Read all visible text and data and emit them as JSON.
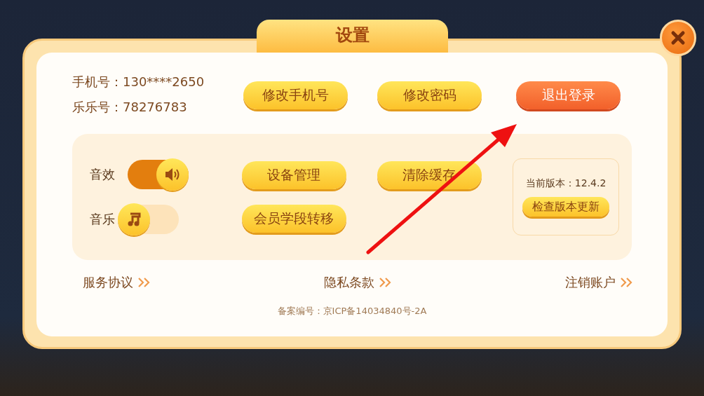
{
  "dialog": {
    "title": "设置"
  },
  "account": [
    "手机号：130****2650",
    "乐乐号：78276783"
  ],
  "account_buttons": [
    {
      "label": "修改手机号",
      "kind": "normal"
    },
    {
      "label": "修改密码",
      "kind": "normal"
    },
    {
      "label": "退出登录",
      "kind": "danger"
    }
  ],
  "toggles": [
    {
      "label": "音效",
      "kind": "sound",
      "on": true
    },
    {
      "label": "音乐",
      "kind": "music",
      "on": false
    }
  ],
  "settings_buttons": [
    "设备管理",
    "清除缓存",
    "会员学段转移"
  ],
  "version": {
    "text": "当前版本：12.4.2",
    "button": "检查版本更新"
  },
  "links": [
    "服务协议",
    "隐私条款",
    "注销账户"
  ],
  "footer": "备案编号：京ICP备14034840号-2A"
}
